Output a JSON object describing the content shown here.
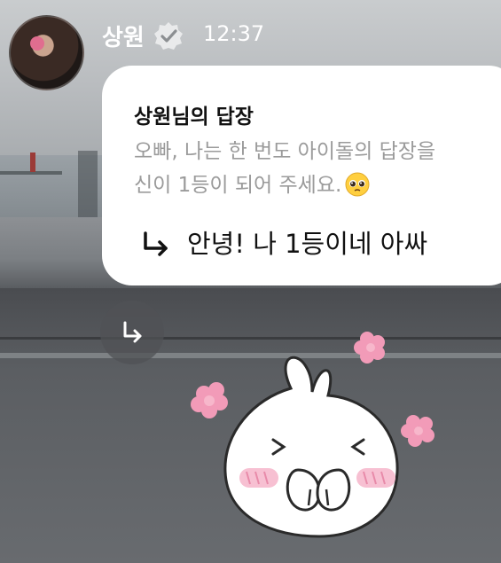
{
  "header": {
    "username": "상원",
    "time": "12:37",
    "verified_icon": "verified-check-icon",
    "avatar": "profile-avatar"
  },
  "reply_card": {
    "title": "상원님의 답장",
    "quote_line1": "오빠, 나는 한 번도 아이돌의 답장을",
    "quote_line2": "신이 1등이 되어 주세요.",
    "quote_emoji": "pleading-face-emoji",
    "answer": "안녕! 나 1등이네 아싸",
    "answer_icon": "reply-arrow-icon"
  },
  "reply_button": {
    "icon": "reply-arrow-icon"
  },
  "sticker": {
    "description_icon": "shy-bunny-sticker"
  },
  "colors": {
    "card_bg": "#ffffff",
    "quote_text": "#9b9b9b",
    "heart_pink": "#f29bb8"
  }
}
